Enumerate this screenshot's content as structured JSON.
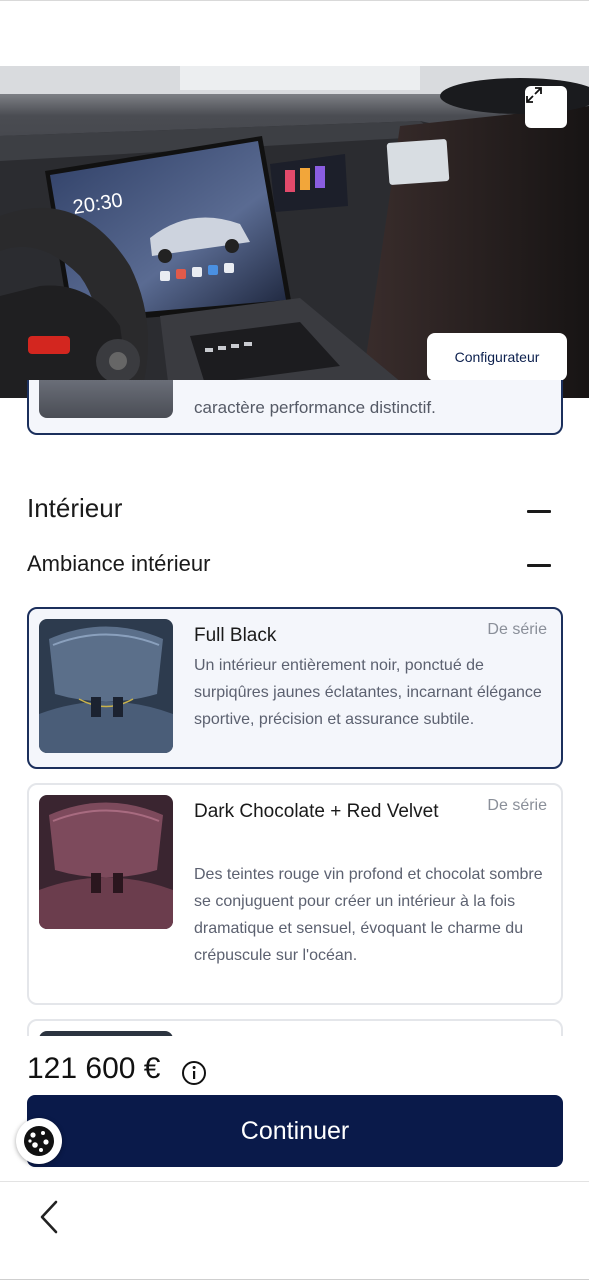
{
  "hero": {
    "screen_time": "20:30",
    "configurator_label": "Configurateur"
  },
  "previous_card": {
    "text": "caractère performance distinctif."
  },
  "section": {
    "title": "Intérieur",
    "subsection_title": "Ambiance intérieur"
  },
  "options": [
    {
      "name": "Full Black",
      "tag": "De série",
      "description": "Un intérieur entièrement noir, ponctué de surpiqûres jaunes éclatantes, incarnant élégance sportive, précision et assurance subtile.",
      "selected": true
    },
    {
      "name": "Dark Chocolate + Red Velvet",
      "tag": "De série",
      "description": "Des teintes rouge vin profond et chocolat sombre se conjuguent pour créer un intérieur à la fois dramatique et sensuel, évoquant le charme du crépuscule sur l'océan.",
      "selected": false
    }
  ],
  "footer": {
    "price": "121 600 €",
    "continue_label": "Continuer"
  },
  "icons": {
    "expand": "expand-icon",
    "info": "info-icon",
    "cookie": "cookie-icon",
    "back": "chevron-left-icon"
  },
  "colors": {
    "primary": "#0a1a4a",
    "selected_border": "#1b2f5c"
  }
}
